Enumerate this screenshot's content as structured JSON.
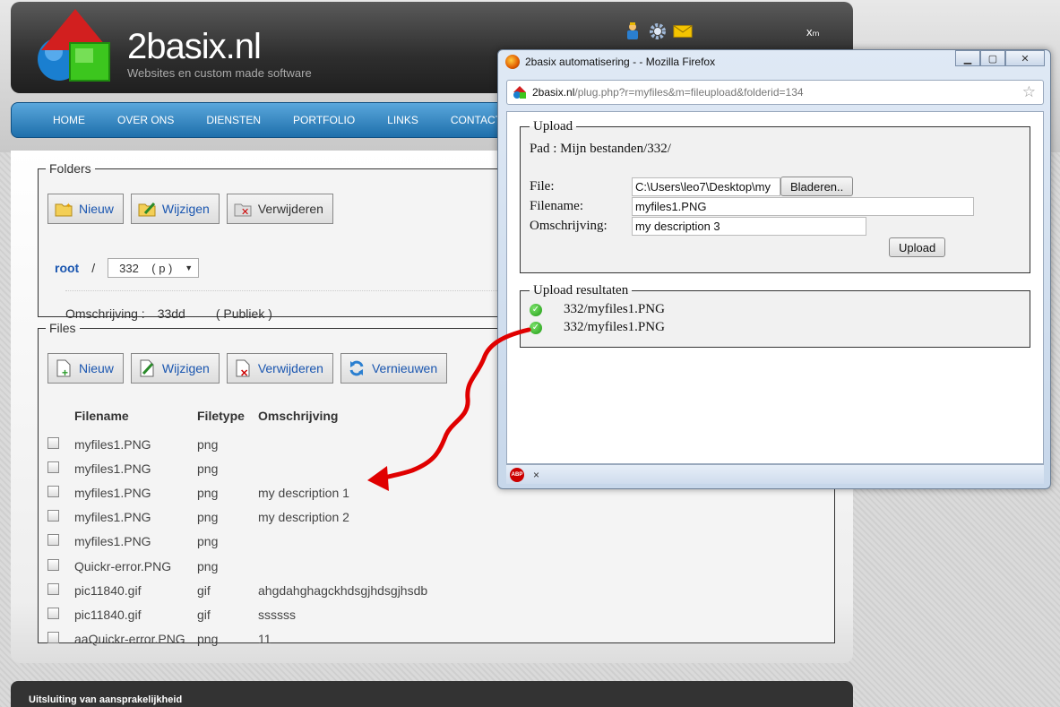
{
  "header": {
    "brand": "2basix.nl",
    "tagline": "Websites en custom made software",
    "user_icon_text": "xₘ",
    "icons": [
      "user-icon",
      "gear-icon",
      "mail-icon"
    ]
  },
  "nav": {
    "items": [
      "HOME",
      "OVER ONS",
      "DIENSTEN",
      "PORTFOLIO",
      "LINKS",
      "CONTACT"
    ]
  },
  "folders": {
    "legend": "Folders",
    "buttons": [
      "Nieuw",
      "Wijzigen",
      "Verwijderen"
    ],
    "root_label": "root",
    "separator": "/",
    "select_value": "332",
    "select_suffix": "( p )",
    "description_label": "Omschrijving :",
    "description_value": "33dd",
    "visibility": "( Publiek )"
  },
  "files": {
    "legend": "Files",
    "buttons": [
      "Nieuw",
      "Wijzigen",
      "Verwijderen",
      "Vernieuwen"
    ],
    "columns": [
      "Filename",
      "Filetype",
      "Omschrijving"
    ],
    "rows": [
      {
        "filename": "myfiles1.PNG",
        "filetype": "png",
        "description": ""
      },
      {
        "filename": "myfiles1.PNG",
        "filetype": "png",
        "description": ""
      },
      {
        "filename": "myfiles1.PNG",
        "filetype": "png",
        "description": "my description 1"
      },
      {
        "filename": "myfiles1.PNG",
        "filetype": "png",
        "description": "my description 2"
      },
      {
        "filename": "myfiles1.PNG",
        "filetype": "png",
        "description": ""
      },
      {
        "filename": "Quickr-error.PNG",
        "filetype": "png",
        "description": ""
      },
      {
        "filename": "pic11840.gif",
        "filetype": "gif",
        "description": "ahgdahghagckhdsgjhdsgjhsdb"
      },
      {
        "filename": "pic11840.gif",
        "filetype": "gif",
        "description": "ssssss"
      },
      {
        "filename": "aaQuickr-error.PNG",
        "filetype": "png",
        "description": "11"
      }
    ]
  },
  "footer": {
    "text": "Uitsluiting van aansprakelijkheid"
  },
  "popup": {
    "title": "2basix automatisering - - Mozilla Firefox",
    "url_host": "2basix.nl",
    "url_rest": "/plug.php?r=myfiles&m=fileupload&folderid=134",
    "upload_legend": "Upload",
    "path_text": "Pad : Mijn bestanden/332/",
    "file_label": "File:",
    "file_value": "C:\\Users\\leo7\\Desktop\\my",
    "browse_label": "Bladeren..",
    "filename_label": "Filename:",
    "filename_value": "myfiles1.PNG",
    "desc_label": "Omschrijving:",
    "desc_value": "my description 3",
    "upload_button": "Upload",
    "results_legend": "Upload resultaten",
    "results": [
      "332/myfiles1.PNG",
      "332/myfiles1.PNG"
    ],
    "status_close": "×",
    "abp_label": "ABP"
  },
  "colors": {
    "nav_blue": "#1e6fab",
    "link_blue": "#1a56b0",
    "annotation_red": "#e00000"
  }
}
